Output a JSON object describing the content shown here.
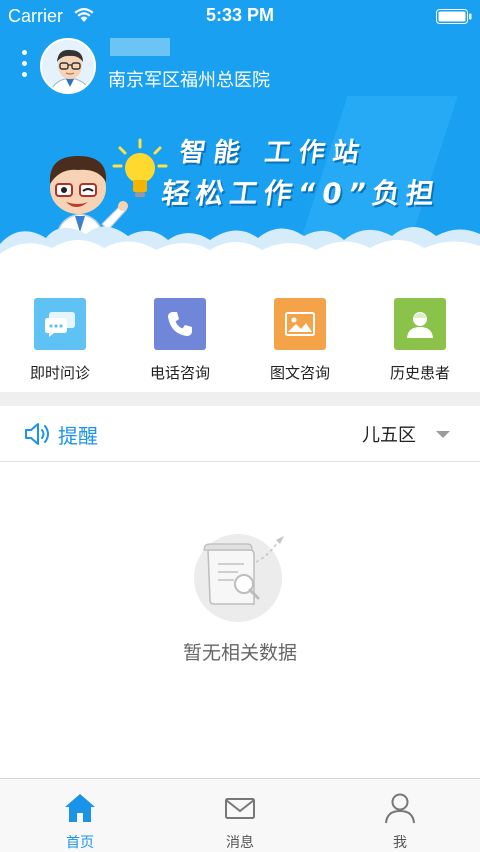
{
  "status_bar": {
    "carrier": "Carrier",
    "time": "5:33 PM"
  },
  "header": {
    "hospital": "南京军区福州总医院"
  },
  "banner": {
    "title": "智能 工作站",
    "subtitle": "轻松工作“0”负担"
  },
  "quick_actions": [
    {
      "label": "即时问诊",
      "icon": "chat-icon",
      "color": "#5ec2f4"
    },
    {
      "label": "电话咨询",
      "icon": "phone-icon",
      "color": "#6f86d9"
    },
    {
      "label": "图文咨询",
      "icon": "image-icon",
      "color": "#f5a349"
    },
    {
      "label": "历史患者",
      "icon": "patient-icon",
      "color": "#8bc34a"
    }
  ],
  "reminder": {
    "label": "提醒",
    "ward": "儿五区"
  },
  "empty": {
    "text": "暂无相关数据"
  },
  "tabs": [
    {
      "label": "首页",
      "icon": "home-icon",
      "active": true
    },
    {
      "label": "消息",
      "icon": "mail-icon",
      "active": false
    },
    {
      "label": "我",
      "icon": "user-icon",
      "active": false
    }
  ],
  "colors": {
    "primary": "#1aa0f0",
    "accent": "#1b93e8",
    "divider": "#efefef"
  }
}
